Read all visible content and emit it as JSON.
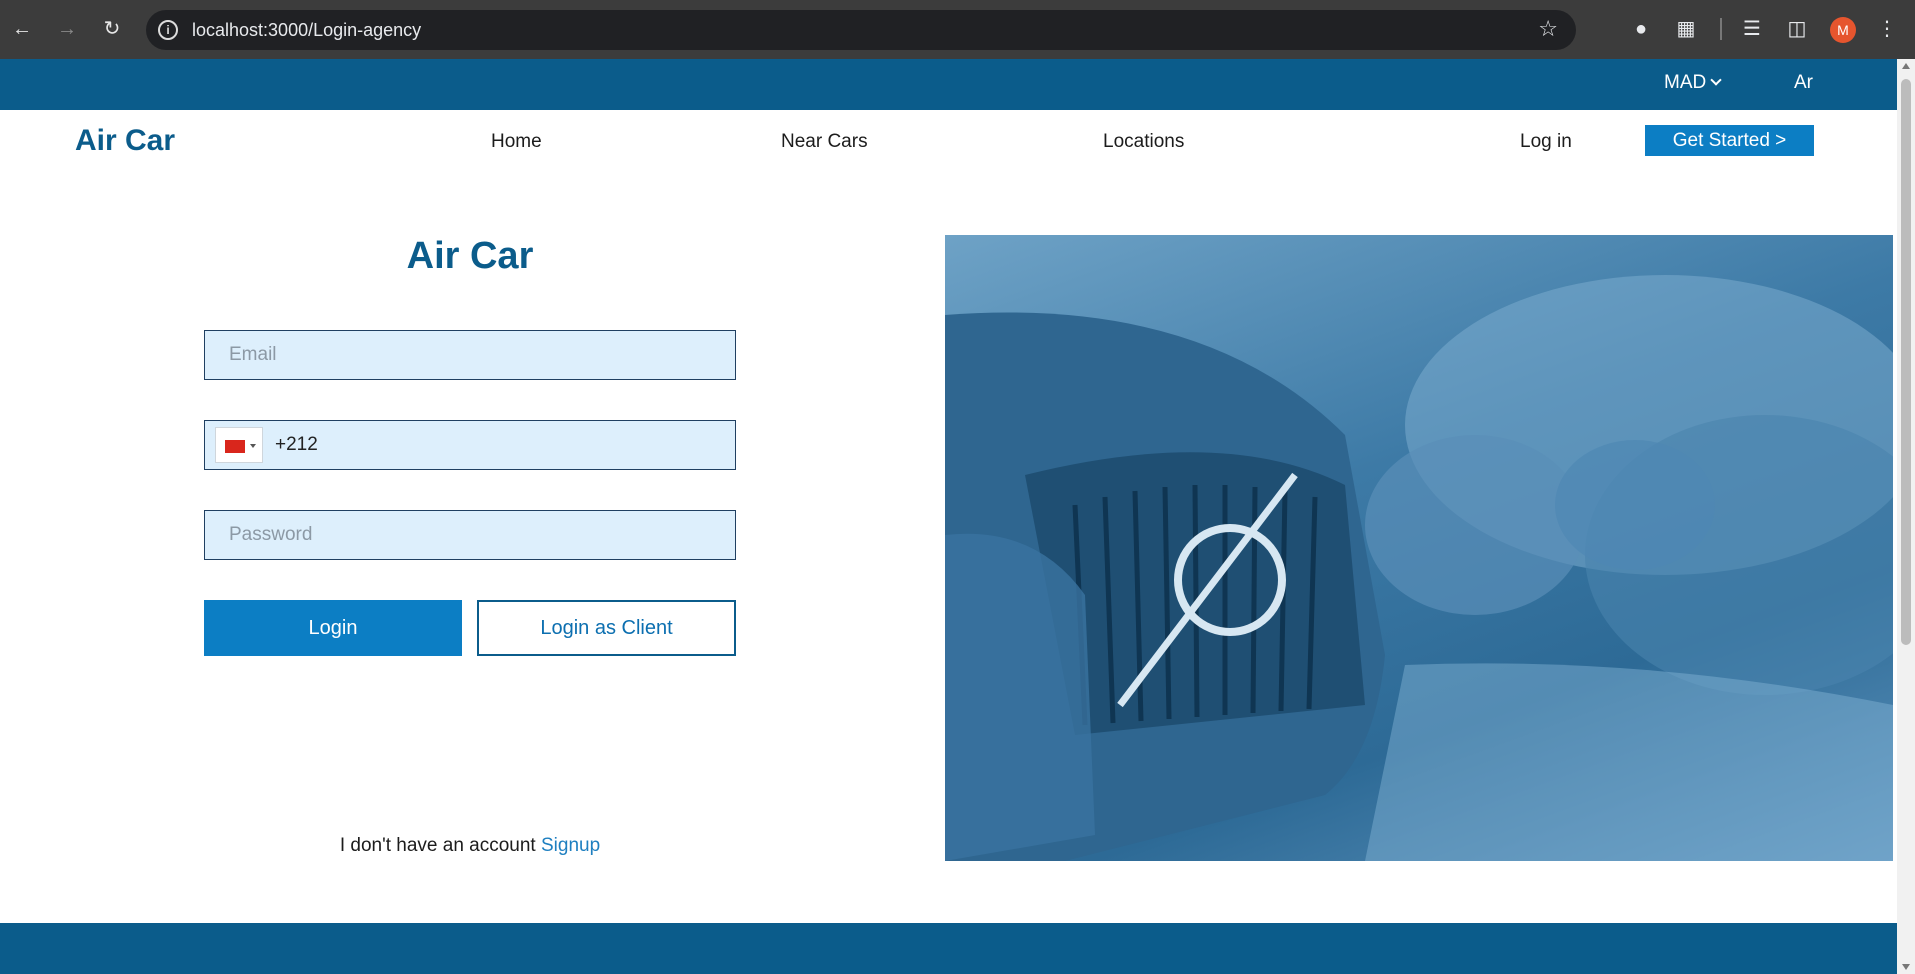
{
  "browser": {
    "url": "localhost:3000/Login-agency",
    "profile_initial": "M"
  },
  "topbar": {
    "currency": "MAD",
    "language": "Ar"
  },
  "navbar": {
    "brand": "Air Car",
    "links": [
      "Home",
      "Near Cars",
      "Locations"
    ],
    "login_label": "Log in",
    "cta_label": "Get Started >"
  },
  "form": {
    "title": "Air Car",
    "email_placeholder": "Email",
    "phone_value": "+212",
    "password_placeholder": "Password",
    "login_label": "Login",
    "client_login_label": "Login as Client",
    "signup_prompt": "I don't have an account",
    "signup_link": "Signup"
  },
  "colors": {
    "brand": "#0b5c8b",
    "accent": "#0c7ec4",
    "field_bg": "#ddeffc"
  },
  "icons": {
    "back": "arrow-left",
    "forward": "arrow-right",
    "reload": "reload",
    "site_info": "info",
    "bookmark": "star",
    "extensions": "puzzle",
    "phone_flag": "flag-morocco"
  }
}
